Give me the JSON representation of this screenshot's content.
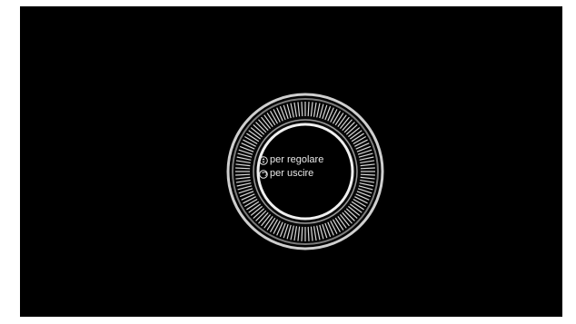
{
  "screen": {
    "background": "#000000",
    "accent": "#d9d9d9"
  },
  "dial": {
    "hints": [
      {
        "icon": "scroll-wheel-icon",
        "label": "per regolare"
      },
      {
        "icon": "back-icon",
        "label": "per uscire"
      }
    ]
  }
}
